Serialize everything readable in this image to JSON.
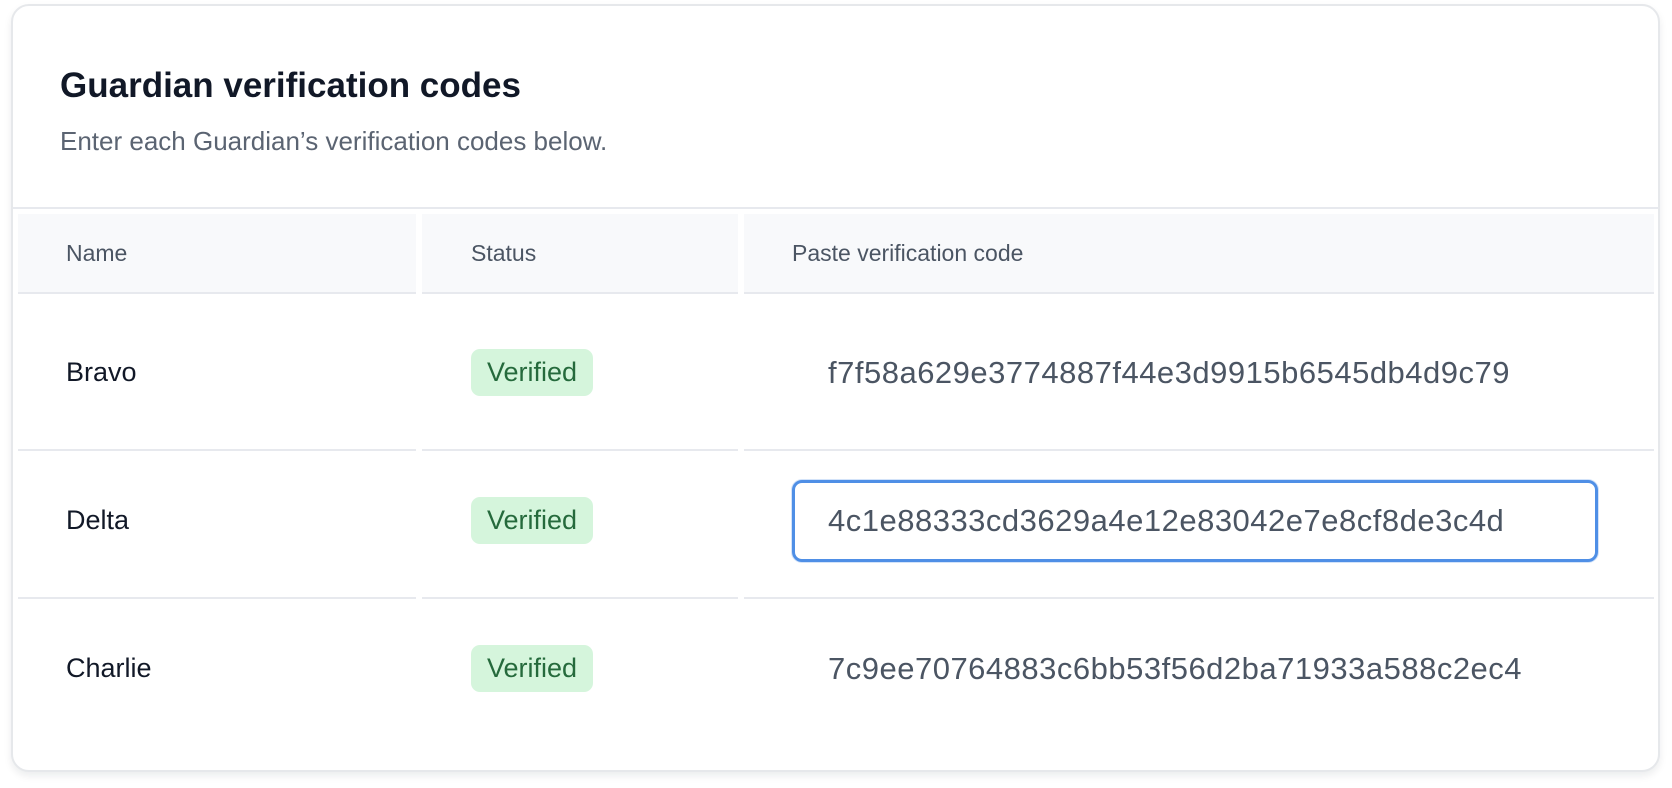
{
  "card": {
    "title": "Guardian verification codes",
    "subtitle": "Enter each Guardian’s verification codes below."
  },
  "table": {
    "headers": {
      "name": "Name",
      "status": "Status",
      "code": "Paste verification code"
    },
    "rows": [
      {
        "name": "Bravo",
        "status": "Verified",
        "code": "f7f58a629e3774887f44e3d9915b6545db4d9c79",
        "focused": false
      },
      {
        "name": "Delta",
        "status": "Verified",
        "code": "4c1e88333cd3629a4e12e83042e7e8cf8de3c4d",
        "focused": true
      },
      {
        "name": "Charlie",
        "status": "Verified",
        "code": "7c9ee70764883c6bb53f56d2ba71933a588c2ec4",
        "focused": false
      }
    ]
  },
  "colors": {
    "badge_bg": "#d5f5dc",
    "badge_text": "#256a3c",
    "focus_ring": "#4f8fe6",
    "header_bg": "#f8f9fb"
  }
}
